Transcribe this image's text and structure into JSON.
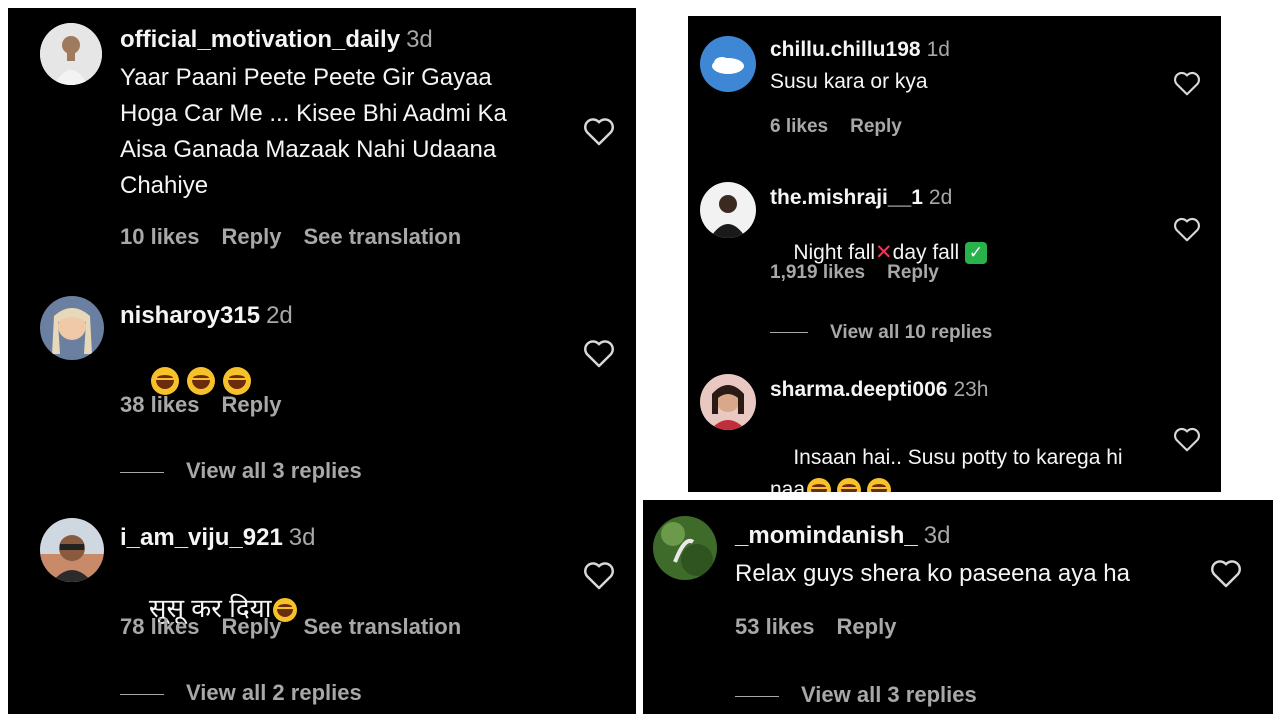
{
  "left_panel": {
    "comments": [
      {
        "username": "official_motivation_daily",
        "time": "3d",
        "text": "Yaar Paani Peete Peete Gir Gayaa\nHoga Car Me ... Kisee Bhi Aadmi Ka\nAisa Ganada Mazaak Nahi Udaana\nChahiye",
        "likes": "10 likes",
        "reply": "Reply",
        "translation": "See translation",
        "avatar_color": "#d9d9d9"
      },
      {
        "username": "nisharoy315",
        "time": "2d",
        "likes": "38 likes",
        "reply": "Reply",
        "view_replies": "View all 3 replies",
        "avatar_color": "#c9a27b"
      },
      {
        "username": "i_am_viju_921",
        "time": "3d",
        "text": "सूसू कर दिया",
        "likes": "78 likes",
        "reply": "Reply",
        "translation": "See translation",
        "view_replies": "View all 2 replies",
        "avatar_color": "#b9876a"
      }
    ]
  },
  "top_right_panel": {
    "comments": [
      {
        "username": "chillu.chillu198",
        "time": "1d",
        "text": "Susu kara or kya",
        "likes": "6 likes",
        "reply": "Reply",
        "avatar_color": "#4a90d9"
      },
      {
        "username": "the.mishraji__1",
        "time": "2d",
        "text_a": "Night fall",
        "text_b": "day fall",
        "likes": "1,919 likes",
        "reply": "Reply",
        "view_replies": "View all 10 replies",
        "avatar_color": "#e8e8e8"
      },
      {
        "username": "sharma.deepti006",
        "time": "23h",
        "text": "Insaan hai.. Susu potty to karega hi",
        "text_line2": "naa",
        "avatar_color": "#c85a5a"
      }
    ]
  },
  "bottom_right_panel": {
    "comment": {
      "username": "_momindanish_",
      "time": "3d",
      "text": "Relax guys shera ko paseena aya ha",
      "likes": "53 likes",
      "reply": "Reply",
      "view_replies": "View all 3 replies",
      "avatar_color": "#5a8a3a"
    }
  },
  "icons": {
    "like": "heart-outline-icon",
    "laugh": "laughing-tears-emoji",
    "cross": "cross-mark-emoji",
    "check": "check-mark-emoji"
  }
}
